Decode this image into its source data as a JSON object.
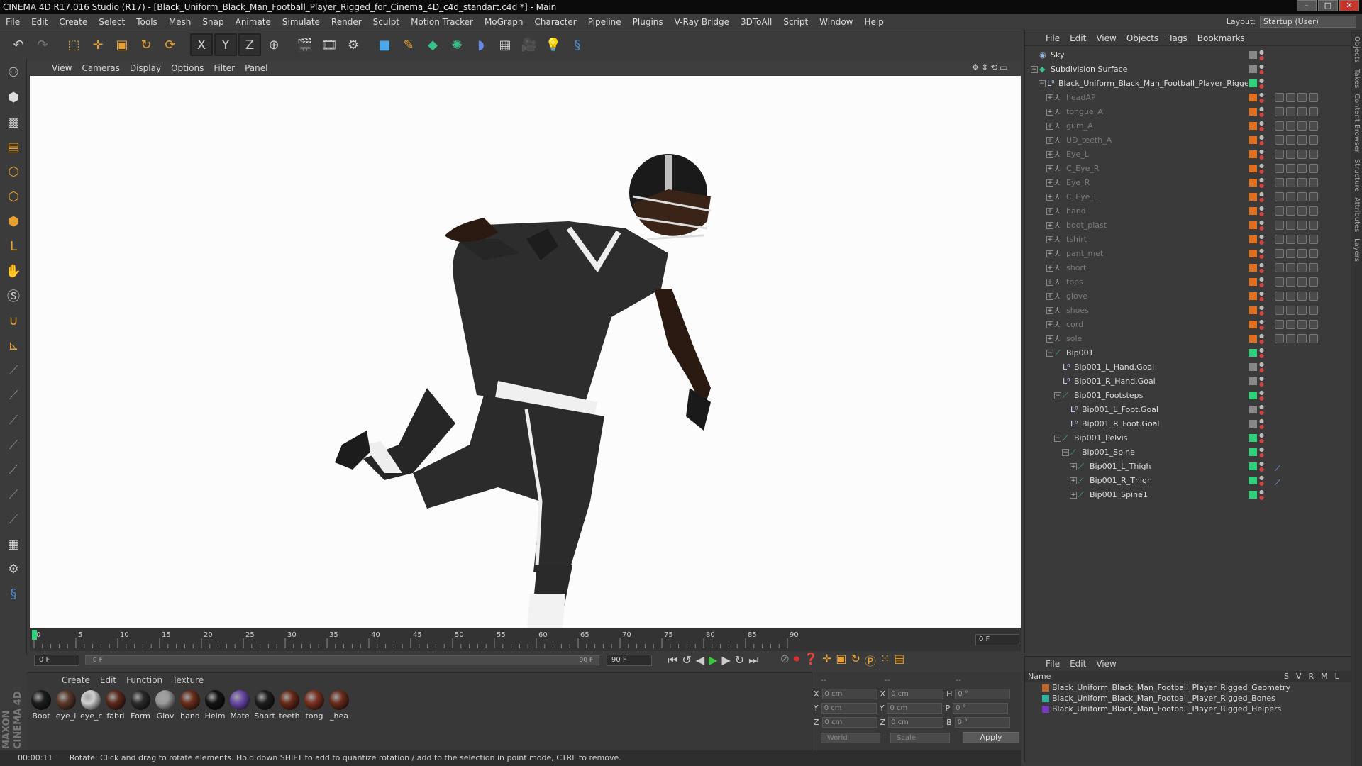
{
  "titlebar": {
    "text": "CINEMA 4D R17.016 Studio (R17) - [Black_Uniform_Black_Man_Football_Player_Rigged_for_Cinema_4D_c4d_standart.c4d *] - Main"
  },
  "menu": [
    "File",
    "Edit",
    "Create",
    "Select",
    "Tools",
    "Mesh",
    "Snap",
    "Animate",
    "Simulate",
    "Render",
    "Sculpt",
    "Motion Tracker",
    "MoGraph",
    "Character",
    "Pipeline",
    "Plugins",
    "V-Ray Bridge",
    "3DToAll",
    "Script",
    "Window",
    "Help"
  ],
  "layout": {
    "label": "Layout:",
    "value": "Startup (User)"
  },
  "view_menu": [
    "View",
    "Cameras",
    "Display",
    "Options",
    "Filter",
    "Panel"
  ],
  "timeline": {
    "ticks": [
      "0",
      "5",
      "10",
      "15",
      "20",
      "25",
      "30",
      "35",
      "40",
      "45",
      "50",
      "55",
      "60",
      "65",
      "70",
      "75",
      "80",
      "85",
      "90"
    ],
    "current_frame": "0 F",
    "start_field": "0 F",
    "slider_start": "0 F",
    "slider_end": "90 F",
    "end_field": "90 F"
  },
  "materials": {
    "menu": [
      "Create",
      "Edit",
      "Function",
      "Texture"
    ],
    "items": [
      {
        "label": "Boot",
        "color": "#1d1d1d"
      },
      {
        "label": "eye_i",
        "color": "#5a3a2a"
      },
      {
        "label": "eye_c",
        "color": "#cfcfcf"
      },
      {
        "label": "fabri",
        "color": "#5b2a1c"
      },
      {
        "label": "Form",
        "color": "#2b2b2b"
      },
      {
        "label": "Glov",
        "color": "#9a9a9a"
      },
      {
        "label": "hand",
        "color": "#6b2e1c"
      },
      {
        "label": "Helm",
        "color": "#141414"
      },
      {
        "label": "Mate",
        "color": "#6a4aa8"
      },
      {
        "label": "Short",
        "color": "#1e1e1e"
      },
      {
        "label": "teeth",
        "color": "#6a2a1a"
      },
      {
        "label": "tong",
        "color": "#7a3020"
      },
      {
        "label": "_hea",
        "color": "#6a2c1c"
      }
    ]
  },
  "coords": {
    "sep1": "--",
    "sep2": "--",
    "sep3": "--",
    "rows": [
      {
        "a": "X",
        "av": "0 cm",
        "b": "X",
        "bv": "0 cm",
        "c": "H",
        "cv": "0 °"
      },
      {
        "a": "Y",
        "av": "0 cm",
        "b": "Y",
        "bv": "0 cm",
        "c": "P",
        "cv": "0 °"
      },
      {
        "a": "Z",
        "av": "0 cm",
        "b": "Z",
        "bv": "0 cm",
        "c": "B",
        "cv": "0 °"
      }
    ],
    "world": "World",
    "scale": "Scale",
    "apply": "Apply"
  },
  "status": {
    "time": "00:00:11",
    "text": "Rotate: Click and drag to rotate elements. Hold down SHIFT to add to quantize rotation / add to the selection in point mode, CTRL to remove."
  },
  "objects": {
    "menu": [
      "File",
      "Edit",
      "View",
      "Objects",
      "Tags",
      "Bookmarks"
    ],
    "rows": [
      {
        "name": "Sky",
        "level": 0,
        "exp": "",
        "icon": "sky",
        "dim": false,
        "flag": "#888"
      },
      {
        "name": "Subdivision Surface",
        "level": 0,
        "exp": "−",
        "icon": "sub",
        "dim": false,
        "flag": "#888"
      },
      {
        "name": "Black_Uniform_Black_Man_Football_Player_Rigged",
        "level": 1,
        "exp": "−",
        "icon": "null",
        "dim": false,
        "flag": "#2fd07a"
      },
      {
        "name": "headAP",
        "level": 2,
        "exp": "+",
        "icon": "bone",
        "dim": true,
        "flag": "#e07020",
        "tags": true
      },
      {
        "name": "tongue_A",
        "level": 2,
        "exp": "+",
        "icon": "bone",
        "dim": true,
        "flag": "#e07020",
        "tags": true
      },
      {
        "name": "gum_A",
        "level": 2,
        "exp": "+",
        "icon": "bone",
        "dim": true,
        "flag": "#e07020",
        "tags": true
      },
      {
        "name": "UD_teeth_A",
        "level": 2,
        "exp": "+",
        "icon": "bone",
        "dim": true,
        "flag": "#e07020",
        "tags": true
      },
      {
        "name": "Eye_L",
        "level": 2,
        "exp": "+",
        "icon": "bone",
        "dim": true,
        "flag": "#e07020",
        "tags": true
      },
      {
        "name": "C_Eye_R",
        "level": 2,
        "exp": "+",
        "icon": "bone",
        "dim": true,
        "flag": "#e07020",
        "tags": true
      },
      {
        "name": "Eye_R",
        "level": 2,
        "exp": "+",
        "icon": "bone",
        "dim": true,
        "flag": "#e07020",
        "tags": true
      },
      {
        "name": "C_Eye_L",
        "level": 2,
        "exp": "+",
        "icon": "bone",
        "dim": true,
        "flag": "#e07020",
        "tags": true
      },
      {
        "name": "hand",
        "level": 2,
        "exp": "+",
        "icon": "bone",
        "dim": true,
        "flag": "#e07020",
        "tags": true
      },
      {
        "name": "boot_plast",
        "level": 2,
        "exp": "+",
        "icon": "bone",
        "dim": true,
        "flag": "#e07020",
        "tags": true
      },
      {
        "name": "tshirt",
        "level": 2,
        "exp": "+",
        "icon": "bone",
        "dim": true,
        "flag": "#e07020",
        "tags": true
      },
      {
        "name": "pant_met",
        "level": 2,
        "exp": "+",
        "icon": "bone",
        "dim": true,
        "flag": "#e07020",
        "tags": true
      },
      {
        "name": "short",
        "level": 2,
        "exp": "+",
        "icon": "bone",
        "dim": true,
        "flag": "#e07020",
        "tags": true
      },
      {
        "name": "tops",
        "level": 2,
        "exp": "+",
        "icon": "bone",
        "dim": true,
        "flag": "#e07020",
        "tags": true
      },
      {
        "name": "glove",
        "level": 2,
        "exp": "+",
        "icon": "bone",
        "dim": true,
        "flag": "#e07020",
        "tags": true
      },
      {
        "name": "shoes",
        "level": 2,
        "exp": "+",
        "icon": "bone",
        "dim": true,
        "flag": "#e07020",
        "tags": true
      },
      {
        "name": "cord",
        "level": 2,
        "exp": "+",
        "icon": "bone",
        "dim": true,
        "flag": "#e07020",
        "tags": true
      },
      {
        "name": "sole",
        "level": 2,
        "exp": "+",
        "icon": "bone",
        "dim": true,
        "flag": "#e07020",
        "tags": true
      },
      {
        "name": "Bip001",
        "level": 2,
        "exp": "−",
        "icon": "joint",
        "dim": false,
        "flag": "#2fd07a"
      },
      {
        "name": "Bip001_L_Hand.Goal",
        "level": 3,
        "exp": "",
        "icon": "null",
        "dim": false,
        "flag": "#888"
      },
      {
        "name": "Bip001_R_Hand.Goal",
        "level": 3,
        "exp": "",
        "icon": "null",
        "dim": false,
        "flag": "#888"
      },
      {
        "name": "Bip001_Footsteps",
        "level": 3,
        "exp": "−",
        "icon": "joint",
        "dim": false,
        "flag": "#2fd07a"
      },
      {
        "name": "Bip001_L_Foot.Goal",
        "level": 4,
        "exp": "",
        "icon": "null",
        "dim": false,
        "flag": "#888"
      },
      {
        "name": "Bip001_R_Foot.Goal",
        "level": 4,
        "exp": "",
        "icon": "null",
        "dim": false,
        "flag": "#888"
      },
      {
        "name": "Bip001_Pelvis",
        "level": 3,
        "exp": "−",
        "icon": "joint",
        "dim": false,
        "flag": "#2fd07a"
      },
      {
        "name": "Bip001_Spine",
        "level": 4,
        "exp": "−",
        "icon": "joint",
        "dim": false,
        "flag": "#2fd07a"
      },
      {
        "name": "Bip001_L_Thigh",
        "level": 5,
        "exp": "+",
        "icon": "joint",
        "dim": false,
        "flag": "#2fd07a",
        "ik": true
      },
      {
        "name": "Bip001_R_Thigh",
        "level": 5,
        "exp": "+",
        "icon": "joint",
        "dim": false,
        "flag": "#2fd07a",
        "ik": true
      },
      {
        "name": "Bip001_Spine1",
        "level": 5,
        "exp": "+",
        "icon": "joint",
        "dim": false,
        "flag": "#2fd07a"
      }
    ]
  },
  "layers": {
    "menu": [
      "File",
      "Edit",
      "View"
    ],
    "header": "Name",
    "cols": [
      "S",
      "V",
      "R",
      "M",
      "L"
    ],
    "rows": [
      {
        "name": "Black_Uniform_Black_Man_Football_Player_Rigged_Geometry",
        "color": "#c0682a"
      },
      {
        "name": "Black_Uniform_Black_Man_Football_Player_Rigged_Bones",
        "color": "#2fb0a0"
      },
      {
        "name": "Black_Uniform_Black_Man_Football_Player_Rigged_Helpers",
        "color": "#7a3ac0"
      }
    ]
  },
  "side_tabs": [
    "Objects",
    "Takes",
    "Content Browser",
    "Structure",
    "Attributes",
    "Layers"
  ],
  "brand": "MAXON CINEMA 4D"
}
